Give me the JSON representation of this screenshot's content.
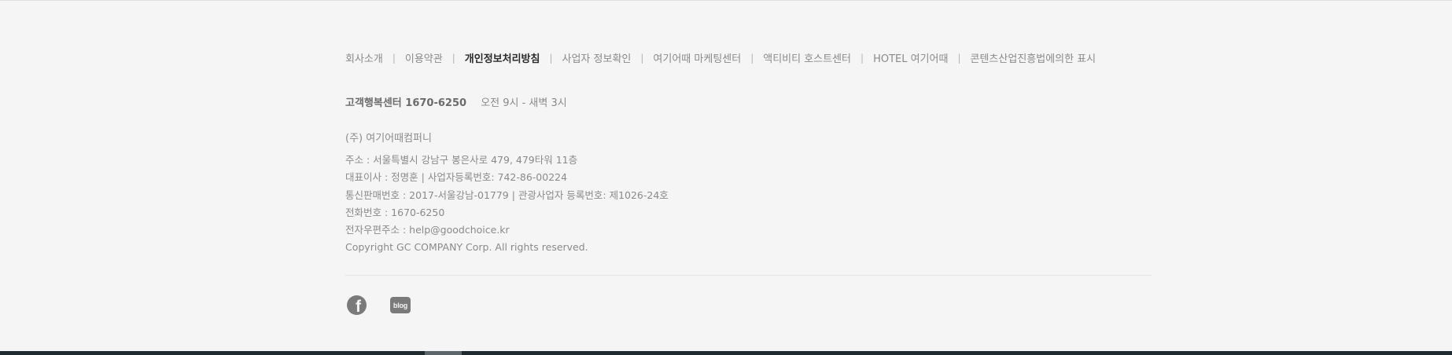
{
  "footer": {
    "links": [
      {
        "label": "회사소개",
        "strong": false
      },
      {
        "label": "이용약관",
        "strong": false
      },
      {
        "label": "개인정보처리방침",
        "strong": true
      },
      {
        "label": "사업자 정보확인",
        "strong": false
      },
      {
        "label": "여기어때 마케팅센터",
        "strong": false
      },
      {
        "label": "액티비티 호스트센터",
        "strong": false
      },
      {
        "label": "HOTEL 여기어때",
        "strong": false
      },
      {
        "label": "콘텐츠산업진흥법에의한 표시",
        "strong": false
      }
    ],
    "separator": "|",
    "support": {
      "phone": "고객행복센터 1670-6250",
      "hours": "오전 9시 - 새벽 3시"
    },
    "company_name": "(주) 여기어때컴퍼니",
    "info_lines": [
      "주소 : 서울특별시 강남구 봉은사로 479, 479타워 11층",
      "대표이사 : 정명훈 | 사업자등록번호: 742-86-00224",
      "통신판매번호 : 2017-서울강남-01779 | 관광사업자 등록번호: 제1026-24호",
      "전화번호 : 1670-6250",
      "전자우편주소 : help@goodchoice.kr",
      "Copyright GC COMPANY Corp. All rights reserved."
    ],
    "social": {
      "facebook_glyph": "f",
      "blog_label": "blog",
      "facebook_icon": "facebook-icon",
      "blog_icon": "blog-icon"
    }
  },
  "colors": {
    "background": "#f6f5f5",
    "text": "#8a8a8a",
    "strong_text": "#2a2a2a",
    "icon": "#7a7a7a",
    "bottom_bar": "#1f2a30"
  }
}
